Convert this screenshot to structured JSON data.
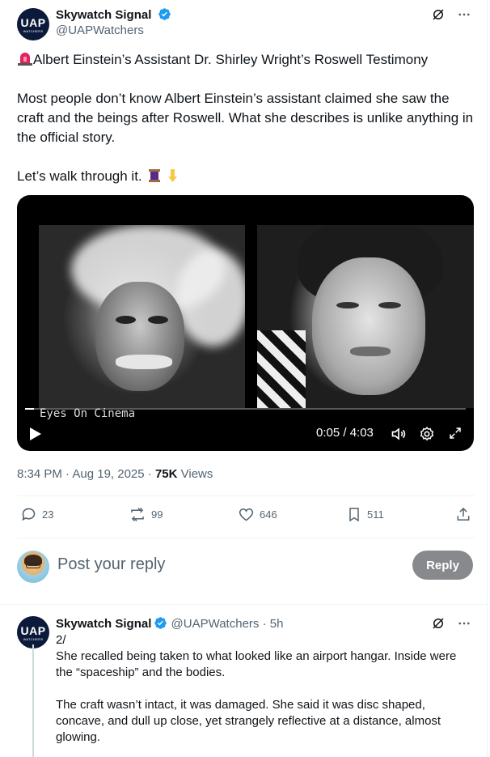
{
  "post": {
    "author_name": "Skywatch Signal",
    "author_handle": "@UAPWatchers",
    "avatar_text": "UAP",
    "avatar_subtext": "WATCHERS",
    "headline": "Albert Einstein’s Assistant Dr. Shirley Wright’s Roswell Testimony",
    "paragraph": "Most people don’t know Albert Einstein’s assistant claimed she saw the craft and the beings after Roswell. What she describes is unlike anything in the official story.",
    "cta": "Let’s walk through it.",
    "timestamp": "8:34 PM · Aug 19, 2025 · ",
    "views_count": "75K",
    "views_label": " Views"
  },
  "video": {
    "watermark": "Eyes On Cinema",
    "time": "0:05 / 4:03",
    "progress": 0.02
  },
  "actions": {
    "replies": "23",
    "reposts": "99",
    "likes": "646",
    "bookmarks": "511"
  },
  "reply_box": {
    "placeholder": "Post your reply",
    "button_label": "Reply"
  },
  "thread_reply": {
    "author_name": "Skywatch Signal",
    "author_handle": "@UAPWatchers",
    "time_ago": "5h",
    "index": "2/",
    "line1": "She recalled being taken to what looked like an airport hangar. Inside were the “spaceship” and the bodies.",
    "line2": "The craft wasn’t intact, it was damaged. She said it was disc shaped, concave, and dull up close, yet strangely reflective at a distance, almost glowing."
  },
  "colors": {
    "verified": "#1d9bf0",
    "muted": "#536471",
    "reply_button": "#87898c"
  }
}
